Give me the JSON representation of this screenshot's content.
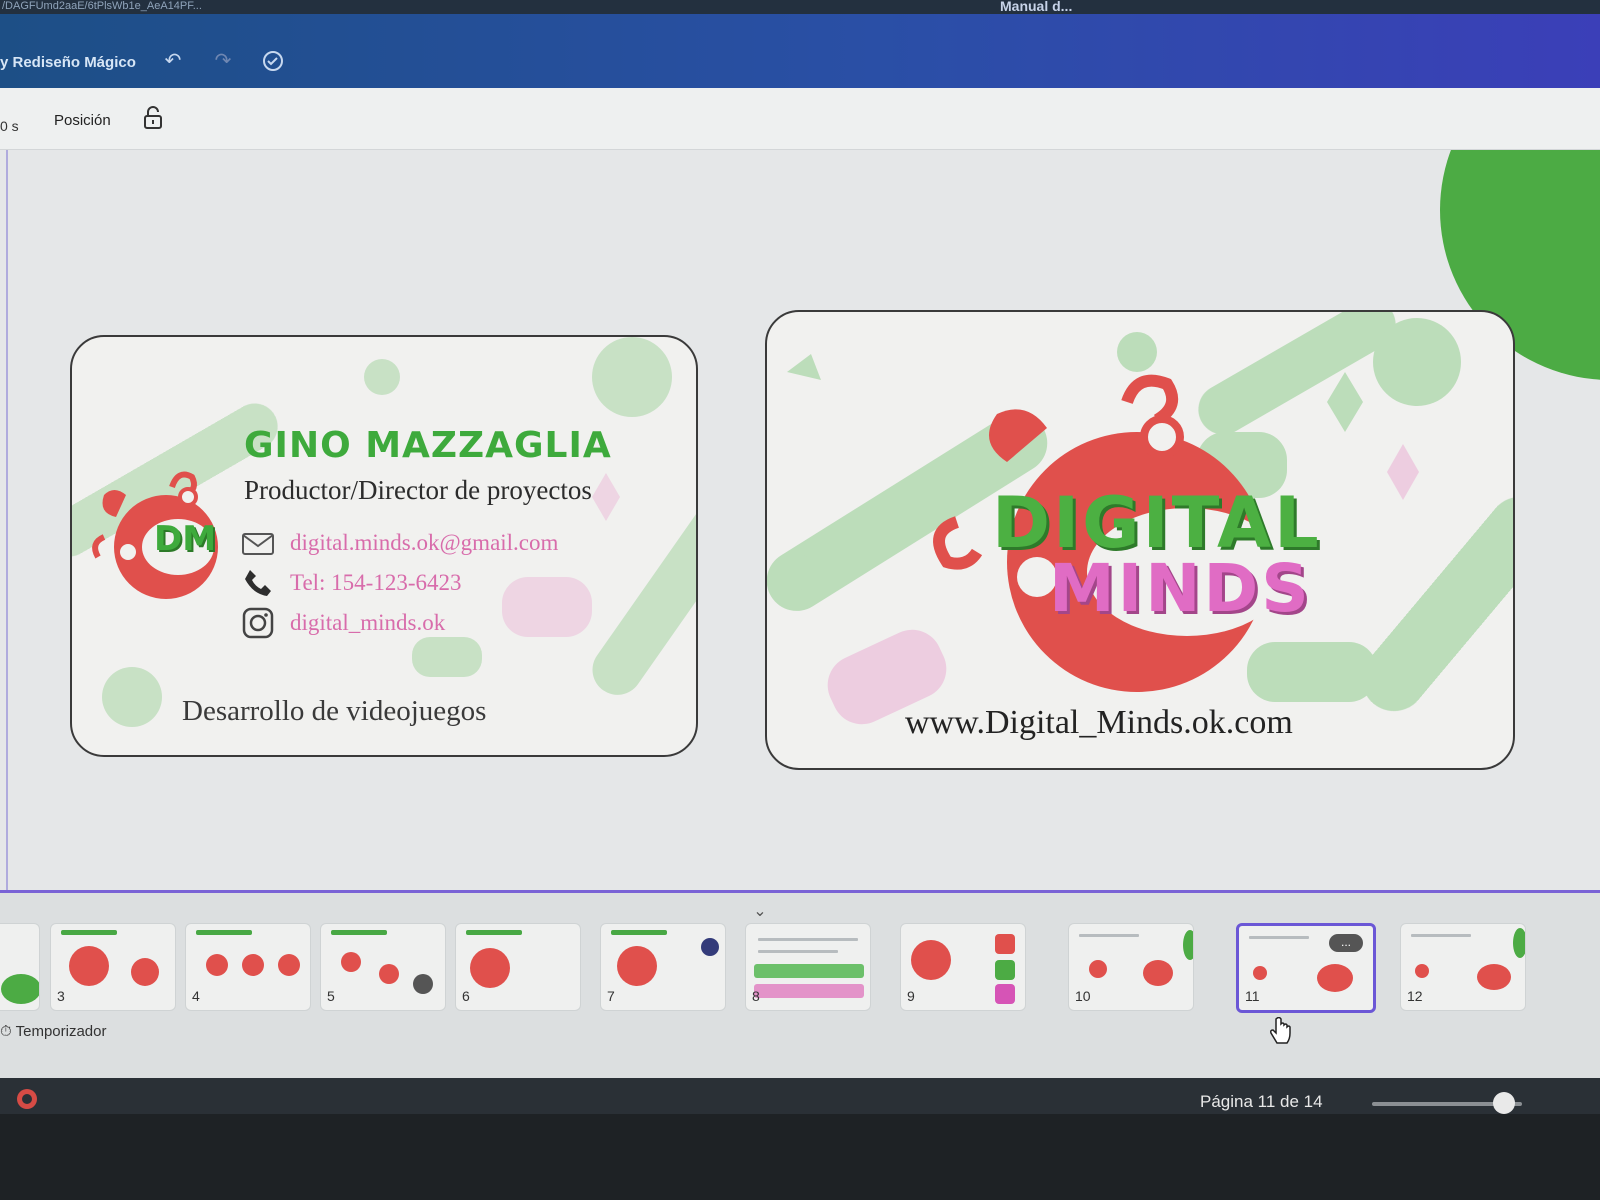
{
  "browser": {
    "url_fragment": "/DAGFUmd2aaE/6tPlsWb1e_AeA14PF..."
  },
  "header": {
    "title": "y Rediseño Mágico",
    "right_text": "Manual d...",
    "undo_icon": "undo-icon",
    "redo_icon": "redo-icon",
    "cloud_icon": "cloud-saved-icon"
  },
  "toolbar": {
    "duration": "0 s",
    "position_label": "Posición",
    "lock_icon": "lock-icon"
  },
  "business_card_front": {
    "name": "GINO MAZZAGLIA",
    "role": "Productor/Director de proyectos",
    "email": "digital.minds.ok@gmail.com",
    "phone": "Tel: 154-123-6423",
    "instagram": "digital_minds.ok",
    "slogan": "Desarrollo de videojuegos",
    "logo_text": "DM"
  },
  "business_card_back": {
    "logo_line1": "DIGITAL",
    "logo_line2": "MINDS",
    "website": "www.Digital_Minds.ok.com"
  },
  "pages_panel": {
    "collapse_icon": "chevron-down-icon",
    "thumbnails": [
      {
        "num": "3"
      },
      {
        "num": "4"
      },
      {
        "num": "5"
      },
      {
        "num": "6"
      },
      {
        "num": "7"
      },
      {
        "num": "8"
      },
      {
        "num": "9"
      },
      {
        "num": "10"
      },
      {
        "num": "11"
      },
      {
        "num": "12"
      }
    ],
    "more_label": "...",
    "timer_label": "Temporizador"
  },
  "status_bar": {
    "page_indicator": "Página 11 de 14",
    "zoom_level_fraction": 0.88
  },
  "colors": {
    "brand_green": "#4cab44",
    "brand_pink": "#e06cc4",
    "brand_red": "#e0504c",
    "selection_purple": "#6b57d6"
  }
}
